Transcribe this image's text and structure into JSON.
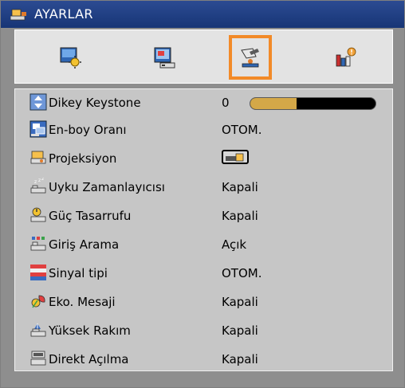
{
  "window": {
    "title": "AYARLAR",
    "title_icon": "menu-settings-icon"
  },
  "tabs": [
    {
      "icon": "image-settings-icon",
      "selected": false
    },
    {
      "icon": "display-settings-icon",
      "selected": false
    },
    {
      "icon": "setup-icon",
      "selected": true
    },
    {
      "icon": "options-info-icon",
      "selected": false
    }
  ],
  "menu": {
    "items": [
      {
        "label": "Dikey Keystone",
        "value": "0",
        "icon": "keystone-icon",
        "slider_fraction": 0.37
      },
      {
        "label": "En-boy Oranı",
        "value": "OTOM.",
        "icon": "aspect-ratio-icon"
      },
      {
        "label": "Projeksiyon",
        "value": "",
        "icon": "projection-icon",
        "value_icon": "front-projection-icon"
      },
      {
        "label": "Uyku Zamanlayıcısı",
        "value": "Kapali",
        "icon": "sleep-timer-icon"
      },
      {
        "label": "Güç Tasarrufu",
        "value": "Kapali",
        "icon": "power-save-icon"
      },
      {
        "label": "Giriş Arama",
        "value": "Açık",
        "icon": "input-search-icon"
      },
      {
        "label": "Sinyal tipi",
        "value": "OTOM.",
        "icon": "signal-type-icon"
      },
      {
        "label": "Eko. Mesaji",
        "value": "Kapali",
        "icon": "eco-message-icon"
      },
      {
        "label": "Yüksek Rakım",
        "value": "Kapali",
        "icon": "high-altitude-icon"
      },
      {
        "label": "Direkt Açılma",
        "value": "Kapali",
        "icon": "direct-power-on-icon"
      }
    ]
  },
  "colors": {
    "titlebar": "#1f3c82",
    "highlight": "#f28a28",
    "slider_fill": "#d4a848",
    "panel": "#c6c6c6"
  }
}
